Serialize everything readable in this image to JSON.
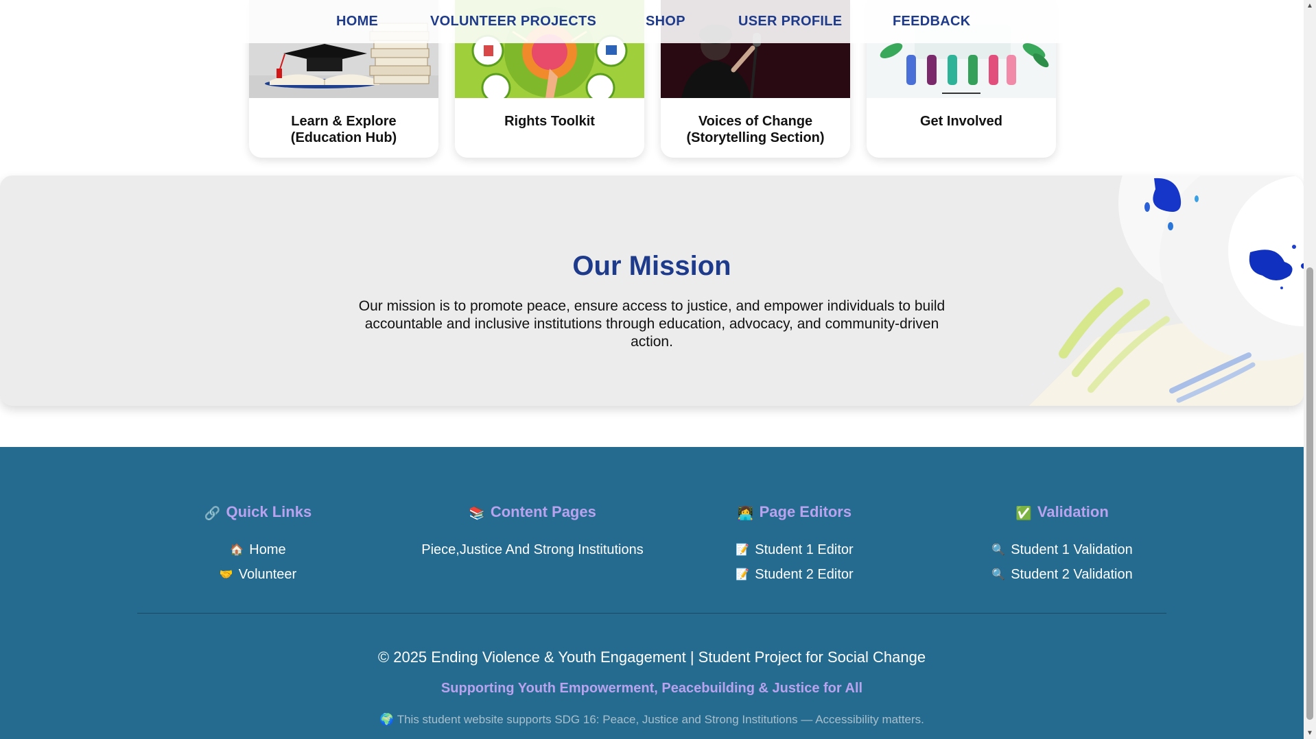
{
  "nav": {
    "items": [
      "HOME",
      "VOLUNTEER PROJECTS",
      "SHOP",
      "USER PROFILE",
      "FEEDBACK"
    ]
  },
  "cards": [
    {
      "title": "Learn & Explore\n(Education Hub)"
    },
    {
      "title": "Rights Toolkit"
    },
    {
      "title": "Voices of Change\n(Storytelling Section)"
    },
    {
      "title": "Get Involved"
    }
  ],
  "mission": {
    "title": "Our Mission",
    "text": "Our mission is to promote peace, ensure access to justice, and empower individuals to build accountable and inclusive institutions through education, advocacy, and community-driven action."
  },
  "footer": {
    "columns": [
      {
        "icon": "🔗",
        "title": "Quick Links",
        "links": [
          {
            "icon": "🏠",
            "label": "Home"
          },
          {
            "icon": "🤝",
            "label": "Volunteer"
          }
        ]
      },
      {
        "icon": "📚",
        "title": "Content Pages",
        "links": [
          {
            "icon": "",
            "label": "Piece,Justice And Strong Institutions"
          }
        ]
      },
      {
        "icon": "👩‍💻",
        "title": "Page Editors",
        "links": [
          {
            "icon": "📝",
            "label": "Student 1 Editor"
          },
          {
            "icon": "📝",
            "label": "Student 2 Editor"
          }
        ]
      },
      {
        "icon": "✅",
        "title": "Validation",
        "links": [
          {
            "icon": "🔍",
            "label": "Student 1 Validation"
          },
          {
            "icon": "🔍",
            "label": "Student 2 Validation"
          }
        ]
      }
    ],
    "copyright": "© 2025 Ending Violence & Youth Engagement | Student Project for Social Change",
    "tagline": "Supporting Youth Empowerment, Peacebuilding & Justice for All",
    "sdg_icon": "🌍",
    "sdg_note": "This student website supports SDG 16: Peace, Justice and Strong Institutions — Accessibility matters."
  },
  "colors": {
    "nav_text": "#1e3a8a",
    "mission_title": "#1e3a8a",
    "footer_bg": "#246b8f",
    "footer_heading": "#b9a3ee",
    "footer_link": "#ffffff"
  }
}
